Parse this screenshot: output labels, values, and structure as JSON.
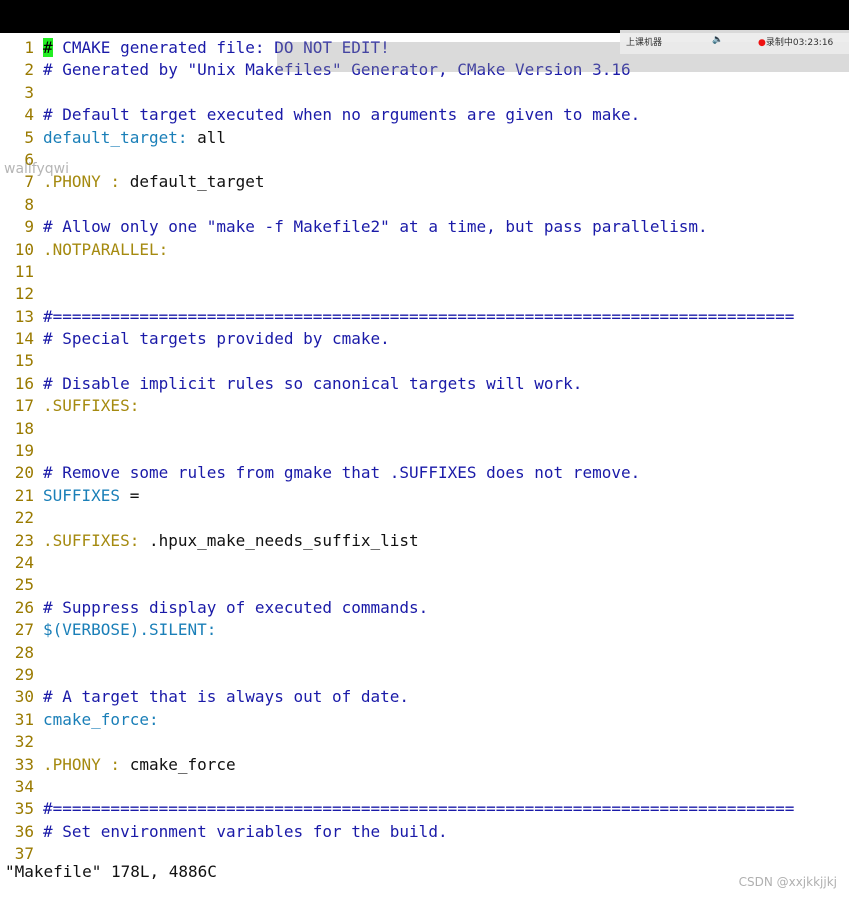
{
  "editor": {
    "lines": [
      {
        "n": "1",
        "parts": [
          {
            "c": "cursor",
            "t": "#"
          },
          {
            "c": "comment",
            "t": " CMAKE generated file: DO NOT EDIT!"
          }
        ]
      },
      {
        "n": "2",
        "parts": [
          {
            "c": "comment",
            "t": "# Generated by \"Unix Makefiles\" Generator, CMake Version 3.16"
          }
        ]
      },
      {
        "n": "3",
        "parts": []
      },
      {
        "n": "4",
        "parts": [
          {
            "c": "comment",
            "t": "# Default target executed when no arguments are given to make."
          }
        ]
      },
      {
        "n": "5",
        "parts": [
          {
            "c": "target",
            "t": "default_target:"
          },
          {
            "c": "txt",
            "t": " all"
          }
        ]
      },
      {
        "n": "6",
        "parts": []
      },
      {
        "n": "7",
        "parts": [
          {
            "c": "special",
            "t": ".PHONY : "
          },
          {
            "c": "txt",
            "t": "default_target"
          }
        ]
      },
      {
        "n": "8",
        "parts": []
      },
      {
        "n": "9",
        "parts": [
          {
            "c": "comment",
            "t": "# Allow only one \"make -f Makefile2\" at a time, but pass parallelism."
          }
        ]
      },
      {
        "n": "10",
        "parts": [
          {
            "c": "special",
            "t": ".NOTPARALLEL:"
          }
        ]
      },
      {
        "n": "11",
        "parts": []
      },
      {
        "n": "12",
        "parts": []
      },
      {
        "n": "13",
        "parts": [
          {
            "c": "comment",
            "t": "#============================================================================="
          }
        ]
      },
      {
        "n": "14",
        "parts": [
          {
            "c": "comment",
            "t": "# Special targets provided by cmake."
          }
        ]
      },
      {
        "n": "15",
        "parts": []
      },
      {
        "n": "16",
        "parts": [
          {
            "c": "comment",
            "t": "# Disable implicit rules so canonical targets will work."
          }
        ]
      },
      {
        "n": "17",
        "parts": [
          {
            "c": "special",
            "t": ".SUFFIXES:"
          }
        ]
      },
      {
        "n": "18",
        "parts": []
      },
      {
        "n": "19",
        "parts": []
      },
      {
        "n": "20",
        "parts": [
          {
            "c": "comment",
            "t": "# Remove some rules from gmake that .SUFFIXES does not remove."
          }
        ]
      },
      {
        "n": "21",
        "parts": [
          {
            "c": "target",
            "t": "SUFFIXES"
          },
          {
            "c": "txt",
            "t": " ="
          }
        ]
      },
      {
        "n": "22",
        "parts": []
      },
      {
        "n": "23",
        "parts": [
          {
            "c": "special",
            "t": ".SUFFIXES:"
          },
          {
            "c": "txt",
            "t": " .hpux_make_needs_suffix_list"
          }
        ]
      },
      {
        "n": "24",
        "parts": []
      },
      {
        "n": "25",
        "parts": []
      },
      {
        "n": "26",
        "parts": [
          {
            "c": "comment",
            "t": "# Suppress display of executed commands."
          }
        ]
      },
      {
        "n": "27",
        "parts": [
          {
            "c": "target",
            "t": "$(VERBOSE).SILENT:"
          }
        ]
      },
      {
        "n": "28",
        "parts": []
      },
      {
        "n": "29",
        "parts": []
      },
      {
        "n": "30",
        "parts": [
          {
            "c": "comment",
            "t": "# A target that is always out of date."
          }
        ]
      },
      {
        "n": "31",
        "parts": [
          {
            "c": "target",
            "t": "cmake_force:"
          }
        ]
      },
      {
        "n": "32",
        "parts": []
      },
      {
        "n": "33",
        "parts": [
          {
            "c": "special",
            "t": ".PHONY : "
          },
          {
            "c": "txt",
            "t": "cmake_force"
          }
        ]
      },
      {
        "n": "34",
        "parts": []
      },
      {
        "n": "35",
        "parts": [
          {
            "c": "comment",
            "t": "#============================================================================="
          }
        ]
      },
      {
        "n": "36",
        "parts": [
          {
            "c": "comment",
            "t": "# Set environment variables for the build."
          }
        ]
      },
      {
        "n": "37",
        "parts": []
      }
    ]
  },
  "status_line": "\"Makefile\" 178L, 4886C",
  "overlay": {
    "rec_menu": "上课机器",
    "rec_status": "录制中03:23:16"
  },
  "watermark": {
    "left": "wallfyqwi",
    "csdn": "CSDN @xxjkkjjkj"
  }
}
